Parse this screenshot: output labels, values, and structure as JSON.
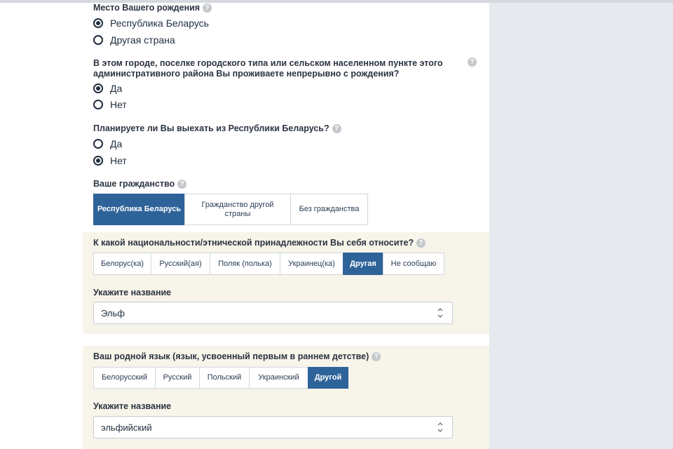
{
  "birthplace": {
    "question": "Место Вашего рождения",
    "options": [
      "Республика Беларусь",
      "Другая страна"
    ],
    "selected": 0
  },
  "continuous_residence": {
    "question_line1": "В этом городе, поселке городского типа или сельском населенном пункте этого",
    "question_line2": "административного района Вы проживаете непрерывно с рождения?",
    "options": [
      "Да",
      "Нет"
    ],
    "selected": 0
  },
  "leave_country": {
    "question": "Планируете ли Вы выехать из Республики Беларусь?",
    "options": [
      "Да",
      "Нет"
    ],
    "selected": 1
  },
  "citizenship": {
    "question": "Ваше гражданство",
    "options": [
      "Республика Беларусь",
      "Гражданство другой страны",
      "Без гражданства"
    ],
    "selected": 0
  },
  "nationality": {
    "question": "К какой национальности/этнической принадлежности Вы себя относите?",
    "options": [
      "Белорус(ка)",
      "Русский(ая)",
      "Поляк (полька)",
      "Украинец(ка)",
      "Другая",
      "Не сообщаю"
    ],
    "selected": 4,
    "name_label": "Укажите название",
    "name_value": "Эльф"
  },
  "native_language": {
    "question": "Ваш родной язык (язык, усвоенный первым в раннем детстве)",
    "options": [
      "Белорусский",
      "Русский",
      "Польский",
      "Украинский",
      "Другой"
    ],
    "selected": 4,
    "name_label": "Укажите название",
    "name_value": "эльфийский"
  },
  "help_symbol": "?",
  "colors": {
    "accent": "#2e6399",
    "band": "#f7f4ea",
    "side": "#e6e9ed"
  }
}
